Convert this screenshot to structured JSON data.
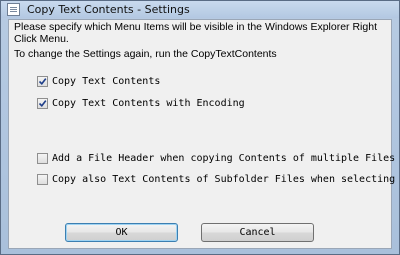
{
  "window": {
    "title": "Copy Text Contents - Settings",
    "icon": "app-document-icon"
  },
  "intro": {
    "line1": "Please specify which Menu Items will be visible in the Windows Explorer Right Click Menu.",
    "line2": "To change the Settings again, run the CopyTextContents"
  },
  "options": [
    {
      "label": "Copy Text Contents",
      "checked": true
    },
    {
      "label": "Copy Text Contents with Encoding",
      "checked": true
    },
    {
      "label": "Add a File Header when copying Contents of multiple Files",
      "checked": false
    },
    {
      "label": "Copy also Text Contents of Subfolder Files when selecting",
      "checked": false
    }
  ],
  "buttons": {
    "ok": "OK",
    "cancel": "Cancel"
  },
  "colors": {
    "check": "#1f3f8a",
    "title_bar": "#b7cbe3",
    "dialog_bg": "#f0f0f0"
  }
}
